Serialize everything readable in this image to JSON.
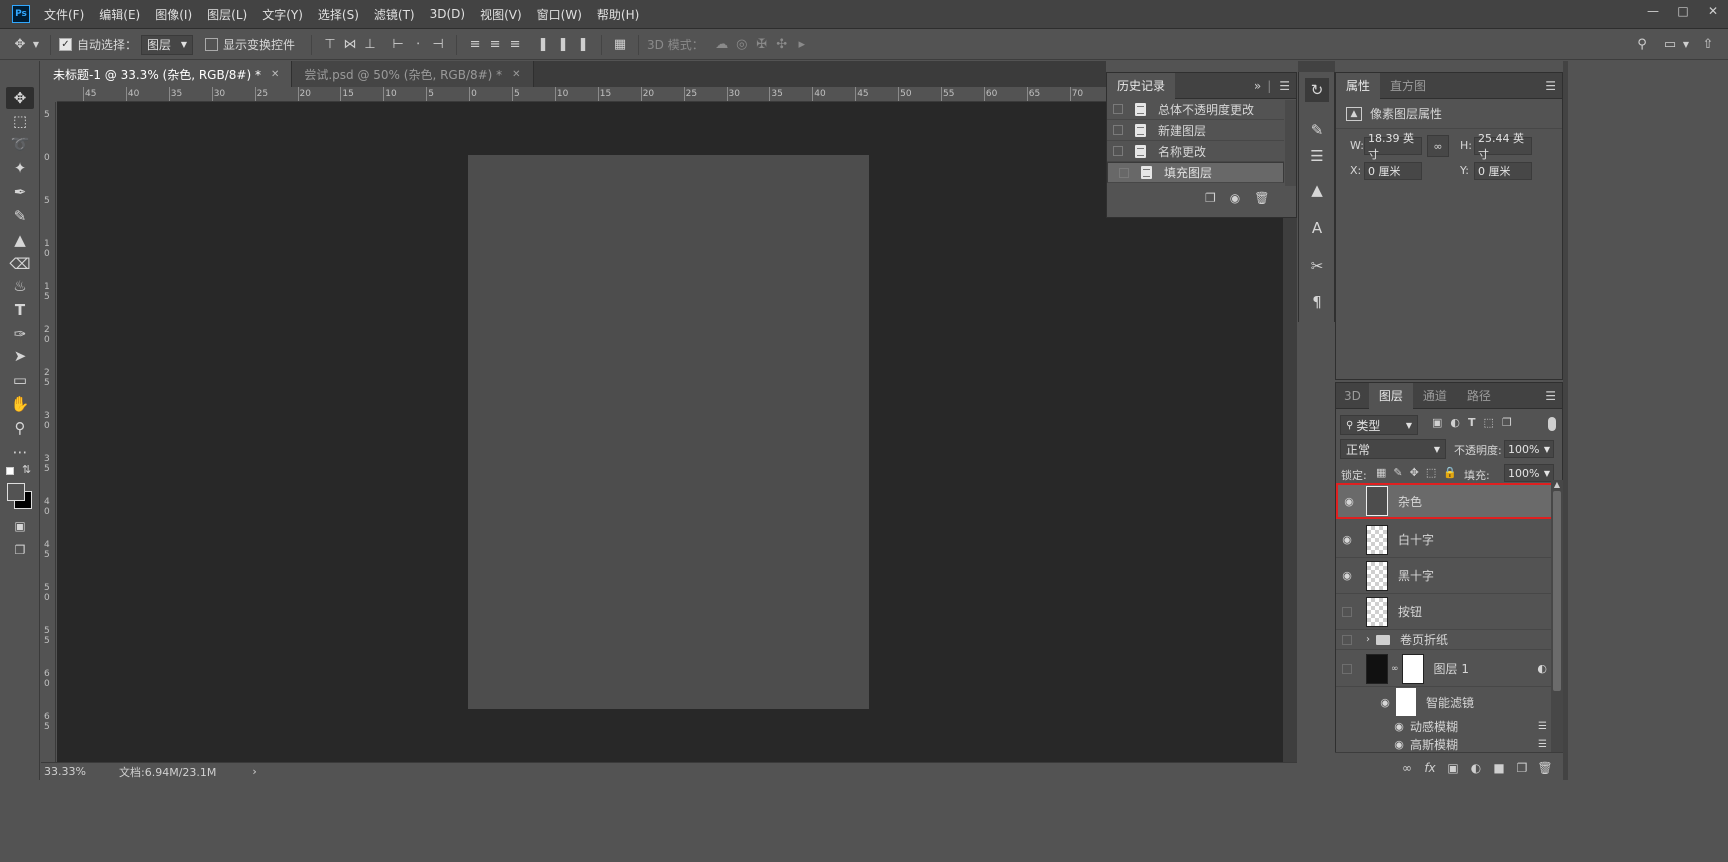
{
  "menu": {
    "items": [
      "文件(F)",
      "编辑(E)",
      "图像(I)",
      "图层(L)",
      "文字(Y)",
      "选择(S)",
      "滤镜(T)",
      "3D(D)",
      "视图(V)",
      "窗口(W)",
      "帮助(H)"
    ]
  },
  "logo_text": "Ps",
  "options": {
    "auto_select_label": "自动选择：",
    "auto_select_value": "图层",
    "show_transform_label": "显示变换控件",
    "mode_3d_label": "3D 模式："
  },
  "tabs": [
    {
      "label": "未标题-1 @ 33.3% (杂色, RGB/8#) *"
    },
    {
      "label": "尝试.psd @ 50% (杂色, RGB/8#) *"
    }
  ],
  "ruler": {
    "h_labels": [
      "45",
      "40",
      "35",
      "30",
      "25",
      "20",
      "15",
      "10",
      "5",
      "0",
      "5",
      "10",
      "15",
      "20",
      "25",
      "30",
      "35",
      "40",
      "45",
      "50",
      "55",
      "60",
      "65",
      "70"
    ],
    "v_labels": [
      "5",
      "0",
      "5",
      "1 0",
      "1 5",
      "2 0",
      "2 5",
      "3 0",
      "3 5",
      "4 0",
      "4 5",
      "5 0",
      "5 5",
      "6 0",
      "6 5"
    ]
  },
  "status": {
    "zoom": "33.33%",
    "doc_info": "文档:6.94M/23.1M"
  },
  "history": {
    "tab_label": "历史记录",
    "items": [
      "总体不透明度更改",
      "新建图层",
      "名称更改",
      "填充图层"
    ],
    "selected": "填充图层"
  },
  "properties": {
    "tabs": [
      "属性",
      "直方图"
    ],
    "section_title": "像素图层属性",
    "w_label": "W:",
    "w_value": "18.39 英寸",
    "h_label": "H:",
    "h_value": "25.44 英寸",
    "x_label": "X:",
    "x_value": "0 厘米",
    "y_label": "Y:",
    "y_value": "0 厘米"
  },
  "layers_panel": {
    "tabs": [
      "3D",
      "图层",
      "通道",
      "路径"
    ],
    "filter_value": "类型",
    "blend_mode": "正常",
    "opacity_label": "不透明度:",
    "opacity_value": "100%",
    "lock_label": "锁定:",
    "fill_label": "填充:",
    "fill_value": "100%",
    "layers": [
      {
        "name": "杂色",
        "visible": true,
        "selected": true
      },
      {
        "name": "白十字",
        "visible": true
      },
      {
        "name": "黑十字",
        "visible": true
      },
      {
        "name": "按钮",
        "visible": false
      },
      {
        "name": "卷页折纸",
        "visible": false,
        "type": "group"
      },
      {
        "name": "图层 1",
        "visible": false
      },
      {
        "name": "智能滤镜",
        "visible": true
      },
      {
        "name": "动感模糊",
        "visible": true
      },
      {
        "name": "高斯模糊",
        "visible": true
      }
    ]
  },
  "colors": {
    "highlight": "#e02020",
    "canvas": "#4d4d4d",
    "workspace": "#282828"
  }
}
